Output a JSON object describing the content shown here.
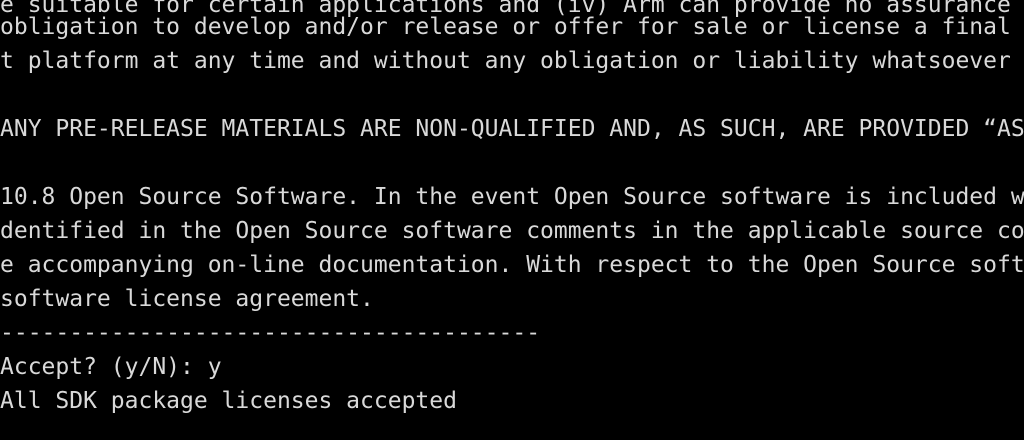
{
  "terminal": {
    "background": "#000000",
    "foreground": "#d9d9d9",
    "lines": [
      "e suitable for certain applications and (iv) Arm can provide no assurance",
      "obligation to develop and/or release or offer for sale or license a final p",
      "t platform at any time and without any obligation or liability whatsoever",
      "",
      "ANY PRE-RELEASE MATERIALS ARE NON-QUALIFIED AND, AS SUCH, ARE PROVIDED “AS",
      "",
      "10.8 Open Source Software. In the event Open Source software is included w",
      "dentified in the Open Source software comments in the applicable source co",
      "e accompanying on-line documentation. With respect to the Open Source soft",
      "software license agreement.",
      "---------------------------------------",
      "Accept? (y/N): y",
      "All SDK package licenses accepted"
    ]
  }
}
